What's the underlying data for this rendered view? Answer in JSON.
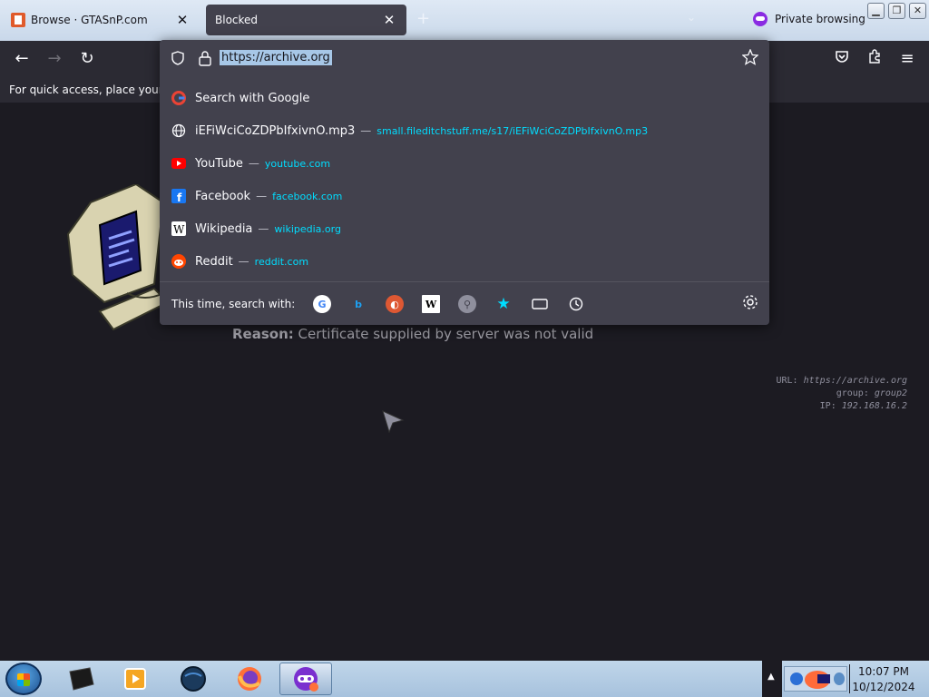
{
  "tabs": [
    {
      "title": "Browse · GTASnP.com"
    },
    {
      "title": "Blocked"
    }
  ],
  "private_label": "Private browsing",
  "bookmarks_hint": "For quick access, place your bookmarks here on the bookmarks toolbar.",
  "urlbar": {
    "value": "https://archive.org",
    "results": [
      {
        "title": "Search with Google",
        "url": "",
        "icon": "google-icon"
      },
      {
        "title": "iEFiWciCoZDPbIfxivnO.mp3",
        "url": "small.fileditchstuff.me/s17/iEFiWciCoZDPbIfxivnO.mp3",
        "icon": "globe-icon"
      },
      {
        "title": "YouTube",
        "url": "youtube.com",
        "icon": "youtube-icon"
      },
      {
        "title": "Facebook",
        "url": "facebook.com",
        "icon": "facebook-icon"
      },
      {
        "title": "Wikipedia",
        "url": "wikipedia.org",
        "icon": "wikipedia-icon"
      },
      {
        "title": "Reddit",
        "url": "reddit.com",
        "icon": "reddit-icon"
      }
    ],
    "oneoff_label": "This time, search with:",
    "engines": [
      "Google",
      "Bing",
      "DuckDuckGo",
      "Wikipedia",
      "Search",
      "Bookmarks",
      "Tabs",
      "History"
    ]
  },
  "page": {
    "reason_label": "Reason:",
    "reason_text": "Certificate supplied by server was not valid",
    "meta_url_label": "URL:",
    "meta_url": "https://archive.org",
    "meta_group_label": "group:",
    "meta_group": "group2",
    "meta_ip_label": "IP:",
    "meta_ip": "192.168.16.2"
  },
  "clock": {
    "time": "10:07 PM",
    "date": "10/12/2024"
  },
  "colors": {
    "accent": "#00ddff",
    "toolbar": "#2b2a33",
    "popup": "#42414d",
    "page": "#1c1b22"
  }
}
